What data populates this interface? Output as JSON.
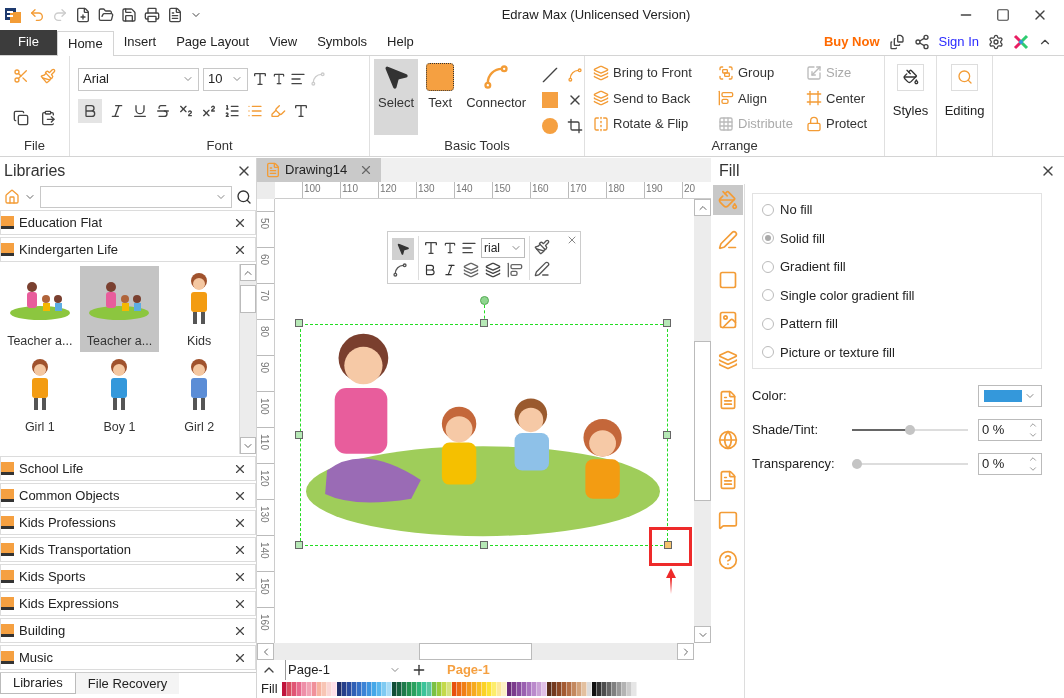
{
  "window": {
    "title": "Edraw Max (Unlicensed Version)"
  },
  "menu_tabs": [
    {
      "label": "File",
      "kind": "backstage",
      "selected": false
    },
    {
      "label": "Home",
      "kind": "tab",
      "selected": true
    },
    {
      "label": "Insert",
      "kind": "tab",
      "selected": false
    },
    {
      "label": "Page Layout",
      "kind": "tab",
      "selected": false
    },
    {
      "label": "View",
      "kind": "tab",
      "selected": false
    },
    {
      "label": "Symbols",
      "kind": "tab",
      "selected": false
    },
    {
      "label": "Help",
      "kind": "tab",
      "selected": false
    }
  ],
  "account": {
    "buy": "Buy Now",
    "sign_in": "Sign In"
  },
  "ribbon": {
    "file_group": "File",
    "font": {
      "label": "Font",
      "family": "Arial",
      "size": "10",
      "bold": true
    },
    "basic_tools": {
      "label": "Basic Tools",
      "tools": [
        {
          "label": "Select",
          "selected": true
        },
        {
          "label": "Text",
          "selected": false
        },
        {
          "label": "Connector",
          "selected": false
        }
      ]
    },
    "arrange": {
      "label": "Arrange",
      "commands": [
        {
          "label": "Bring to Front",
          "disabled": false
        },
        {
          "label": "Group",
          "disabled": false
        },
        {
          "label": "Size",
          "disabled": true
        },
        {
          "label": "Send to Back",
          "disabled": false
        },
        {
          "label": "Align",
          "disabled": false
        },
        {
          "label": "Center",
          "disabled": false
        },
        {
          "label": "Rotate & Flip",
          "disabled": false
        },
        {
          "label": "Distribute",
          "disabled": true
        },
        {
          "label": "Protect",
          "disabled": false
        }
      ]
    },
    "styles": "Styles",
    "editing": "Editing"
  },
  "libraries": {
    "title": "Libraries",
    "categories": [
      {
        "name": "Education Flat"
      },
      {
        "name": "Kindergarten Life",
        "items": [
          {
            "label": "Teacher a...",
            "selected": false
          },
          {
            "label": "Teacher a...",
            "selected": true
          },
          {
            "label": "Kids",
            "selected": false
          },
          {
            "label": "Girl 1",
            "selected": false
          },
          {
            "label": "Boy 1",
            "selected": false
          },
          {
            "label": "Girl 2",
            "selected": false
          }
        ]
      },
      {
        "name": "School Life"
      },
      {
        "name": "Common Objects"
      },
      {
        "name": "Kids Professions"
      },
      {
        "name": "Kids Transportation"
      },
      {
        "name": "Kids Sports"
      },
      {
        "name": "Kids Expressions"
      },
      {
        "name": "Building"
      },
      {
        "name": "Music"
      }
    ],
    "bottom_tabs": [
      {
        "label": "Libraries",
        "selected": true
      },
      {
        "label": "File Recovery",
        "selected": false
      }
    ]
  },
  "document_tab": "Drawing14",
  "ruler": {
    "horizontal": [
      "100",
      "110",
      "120",
      "130",
      "140",
      "150",
      "160",
      "170",
      "180",
      "190",
      "20"
    ],
    "vertical": [
      "50",
      "60",
      "70",
      "80",
      "90",
      "100",
      "110",
      "120",
      "130",
      "140",
      "150",
      "160"
    ]
  },
  "mini_toolbar": {
    "font": "rial"
  },
  "page_bar": {
    "current": "Page-1",
    "tabs": [
      {
        "label": "Page-1",
        "selected": true
      }
    ]
  },
  "palette_label": "Fill",
  "fill_panel": {
    "title": "Fill",
    "side_tabs": [
      {
        "selected": true
      },
      {
        "selected": false
      },
      {
        "selected": false
      },
      {
        "selected": false
      },
      {
        "selected": false
      },
      {
        "selected": false
      },
      {
        "selected": false
      },
      {
        "selected": false
      },
      {
        "selected": false
      },
      {
        "selected": false
      }
    ],
    "options": [
      {
        "label": "No fill",
        "selected": false
      },
      {
        "label": "Solid fill",
        "selected": true
      },
      {
        "label": "Gradient fill",
        "selected": false
      },
      {
        "label": "Single color gradient fill",
        "selected": false
      },
      {
        "label": "Pattern fill",
        "selected": false
      },
      {
        "label": "Picture or texture fill",
        "selected": false
      }
    ],
    "color": {
      "label": "Color:",
      "color": "#3498db"
    },
    "sliders": [
      {
        "label": "Shade/Tint:",
        "level": 0.5,
        "reading": "0 %"
      },
      {
        "label": "Transparency:",
        "level": 0,
        "reading": "0 %"
      }
    ]
  }
}
